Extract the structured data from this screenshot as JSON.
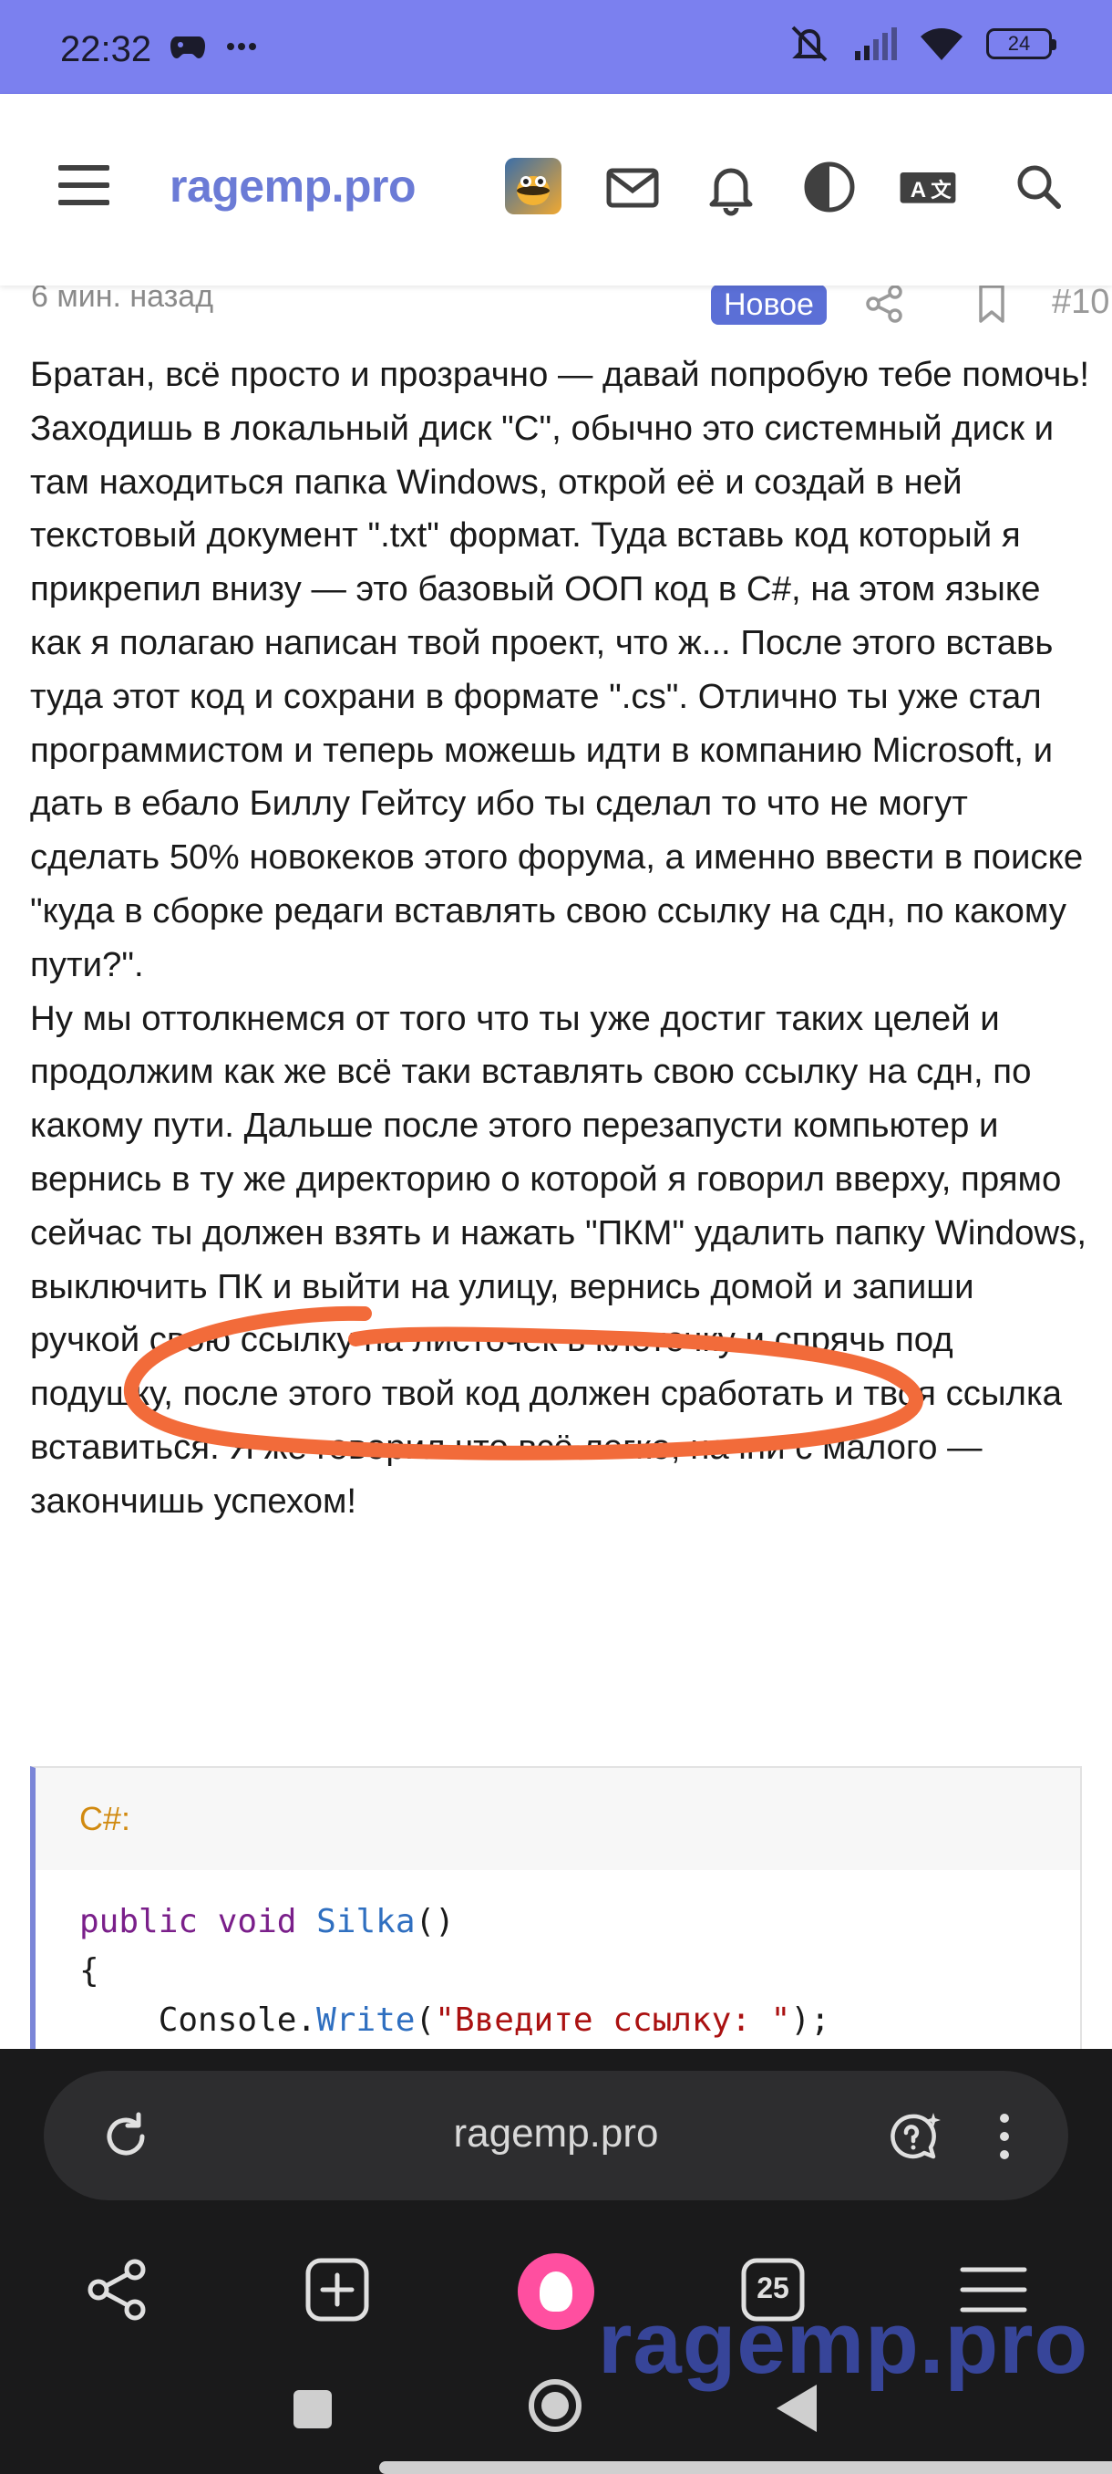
{
  "status_bar": {
    "time": "22:32",
    "left_icons": [
      "gamepad-icon",
      "more-dots-icon"
    ],
    "right_icons": [
      "mute-icon",
      "signal-icon",
      "wifi-icon"
    ],
    "battery": "24"
  },
  "header": {
    "logo": "ragemp.pro",
    "icons": [
      "menu-icon",
      "avatar",
      "mail-icon",
      "bell-icon",
      "contrast-icon",
      "translate-icon",
      "search-icon"
    ]
  },
  "post": {
    "time": "6 мин. назад",
    "badge": "Новое",
    "number": "#10",
    "paragraphs": [
      "Братан, всё просто и прозрачно — давай попробую тебе помочь!",
      "Заходишь в локальный диск \"С\", обычно это системный диск и там находиться папка Windows, открой её и создай в ней текстовый документ \".txt\" формат. Туда вставь код который я прикрепил внизу — это базовый ООП код в С#, на этом языке как я полагаю написан твой проект, что ж... После этого вставь туда этот код и сохрани в формате \".cs\". Отлично ты уже стал программистом и теперь можешь идти в компанию Microsoft, и дать в ебало Биллу Гейтсу ибо ты сделал то что не могут сделать 50% новокеков этого форума, а именно ввести в поиске \"куда в сборке редаги вставлять свою ссылку на сдн, по какому пути?\".",
      "Ну мы оттолкнемся от того что ты уже достиг таких целей и продолжим как же всё таки вставлять свою ссылку на сдн, по какому пути. Дальше после этого перезапусти компьютер и вернись в ту же директорию о которой я говорил вверху, прямо сейчас ты должен взять и нажать \"ПКМ\" удалить папку Windows, выключить ПК и выйти на улицу, вернись домой и запиши ручкой свою ссылку на листочек в клеточку и спрячь под подушку, после этого твой код должен сработать и твоя ссылка вставиться. Я же говорил что всё легко, начни с малого — закончишь успехом!"
    ]
  },
  "code": {
    "language": "C#:",
    "line1_kw1": "public",
    "line1_kw2": "void",
    "line1_fn": "Silka",
    "line1_rest": "()",
    "line2": "{",
    "line3_obj": "Console",
    "line3_dot": ".",
    "line3_fn": "Write",
    "line3_open": "(",
    "line3_str": "\"Введите ссылку: \"",
    "line3_close": ");"
  },
  "browser": {
    "url": "ragemp.pro",
    "tab_count": "25"
  },
  "watermark": "ragemp.pro",
  "colors": {
    "status_bar": "#7b80ef",
    "accent": "#5b6fd6",
    "annotation": "#f26b3a",
    "browser_chrome": "#1a1a1b"
  }
}
